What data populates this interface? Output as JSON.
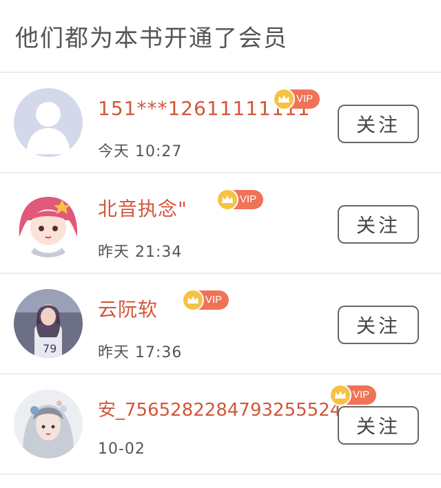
{
  "header": {
    "title": "他们都为本书开通了会员"
  },
  "vip_badge_label": "VIP",
  "follow_label": "关注",
  "members": [
    {
      "name": "151***12611111111",
      "time": "今天 10:27",
      "avatar": "default-avatar-icon"
    },
    {
      "name": "北音执念\"",
      "time": "昨天 21:34",
      "avatar": "anime-girl-avatar"
    },
    {
      "name": "云阮软",
      "time": "昨天 17:36",
      "avatar": "photo-avatar"
    },
    {
      "name": "安_7565282284793255524",
      "time": "10-02",
      "avatar": "illustration-avatar"
    }
  ],
  "colors": {
    "name": "#d2553a",
    "vip_badge": "#ef7357",
    "crown": "#f6c244",
    "divider": "#ececec"
  }
}
